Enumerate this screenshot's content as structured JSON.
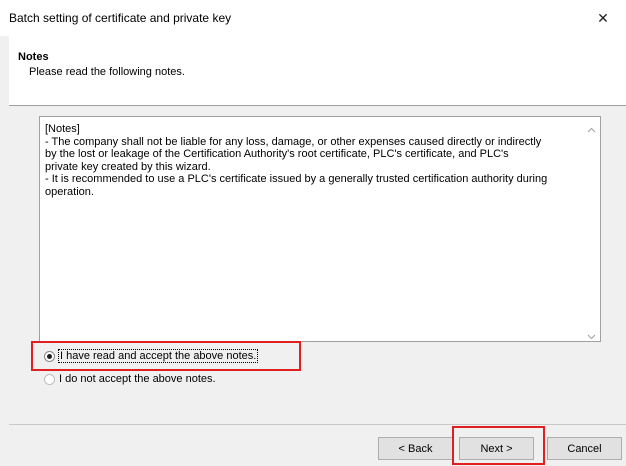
{
  "window": {
    "title": "Batch setting of certificate and private key",
    "close_symbol": "✕"
  },
  "header": {
    "title": "Notes",
    "subtitle": "Please read the following notes."
  },
  "notes": {
    "text": "[Notes]\n- The company shall not be liable for any loss, damage, or other expenses caused directly or indirectly\nby the lost or leakage of the Certification Authority's root certificate, PLC's certificate, and PLC's\nprivate key created by this wizard.\n- It is recommended to use a PLC's certificate issued by a generally trusted certification authority during\noperation."
  },
  "options": {
    "accept_label": "I have read and accept the above notes.",
    "decline_label": "I do not accept the above notes.",
    "selected": "accept"
  },
  "buttons": {
    "back": "< Back",
    "next": "Next >",
    "cancel": "Cancel"
  },
  "colors": {
    "highlight": "#e02020"
  },
  "icons": {
    "close": "close-icon",
    "scroll_up": "chevron-up-icon",
    "scroll_down": "chevron-down-icon"
  }
}
